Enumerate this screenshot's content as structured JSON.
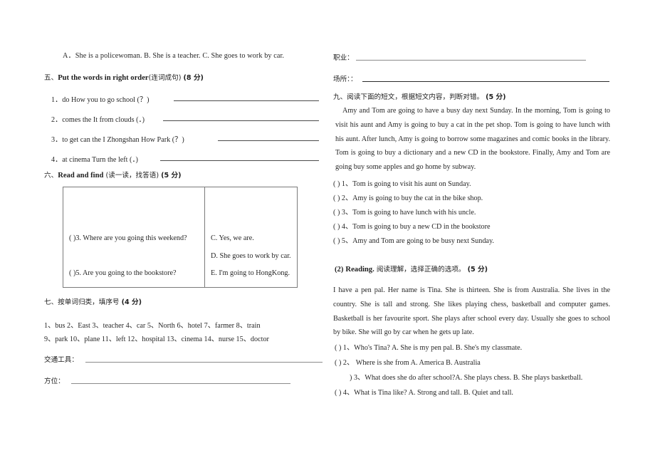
{
  "left": {
    "options_line": "A．She is a policewoman.    B. She is a teacher.     C. She goes to work by car.",
    "section5": {
      "number": "五、",
      "title_en": "Put the words in right order",
      "title_cn": "(连词成句)",
      "score": "(8 分)",
      "items": [
        {
          "num": "1．",
          "words": "do    How    you    to    go    school    (？)"
        },
        {
          "num": "2．",
          "words": "comes    the    It    from    clouds    (．)"
        },
        {
          "num": "3．",
          "words": "to    get   can    the   I   Zhongshan   How   Park    (？)"
        },
        {
          "num": "4．",
          "words": "at    cinema    Turn    the    left    (．)"
        }
      ]
    },
    "section6": {
      "number": "六、",
      "title_en": "Read and find",
      "title_cn": "(读一读，找答语)",
      "score": "(5 分)",
      "questions": [
        "(    )3. Where are you going this weekend?",
        "(    )5. Are you going to the bookstore?"
      ],
      "answers": [
        "C. Yes, we are.",
        "D. She goes to work by car.",
        "E. I'm going to HongKong."
      ]
    },
    "section7": {
      "title": "七、按单词归类，填序号",
      "score": "(4 分)",
      "bank_line1": "1、bus   2、East   3、teacher   4、car    5、North      6、hotel   7、farmer   8、train",
      "bank_line2": "9、park   10、plane   11、left    12、hospital      13、cinema     14、nurse 15、doctor",
      "blank_labels": [
        "交通工具：",
        "方位："
      ]
    }
  },
  "right": {
    "fill_labels": {
      "occupation": "职业：",
      "place": "场所：："
    },
    "section9": {
      "title": "九、阅读下面的短文，根据短文内容，判断对错。",
      "score": "(5 分)",
      "passage": "Amy and Tom are going to have a busy day next Sunday. In the morning, Tom is going to visit his aunt and Amy  is going to  buy a cat in the pet  shop. Tom is going to  have lunch with his aunt. After lunch, Amy is going to borrow some magazines and comic books in the library. Tom is going to buy a dictionary and a new CD in the bookstore. Finally, Amy and Tom are going buy some apples and go home by subway.",
      "tf_items": [
        "(    ) 1、Tom is going to visit his aunt on Sunday.",
        "(    ) 2、Amy is going to buy the cat in the bike shop.",
        "(    ) 3、Tom is going to have lunch with his uncle.",
        "(    ) 4、Tom is going to buy a new CD in the bookstore",
        "(    ) 5、Amy and Tom are going to be busy next Sunday."
      ]
    },
    "reading": {
      "number": "(2)",
      "title_en": "Reading.",
      "title_cn": "阅读理解，选择正确的选项。",
      "score": "(5 分)",
      "passage": "I have a pen pal. Her name is Tina. She is thirteen. She is from Australia. She lives in the country. She is tall and strong. She likes playing chess, basketball and computer games. Basketball is her favourite sport. She plays after school every day. Usually she goes to school by bike. She will go by car when he gets up late.",
      "mc_items": [
        "(    ) 1、Who's Tina?     A. She is my pen pal.            B. She's my classmate.",
        "(    ) 2、   Where is she from     A. America             B. Australia",
        ") 3、What does she do after school?A. She plays chess.    B. She plays basketball.",
        "(    ) 4、What is Tina like? A. Strong and tall.          B. Quiet and tall."
      ]
    }
  }
}
